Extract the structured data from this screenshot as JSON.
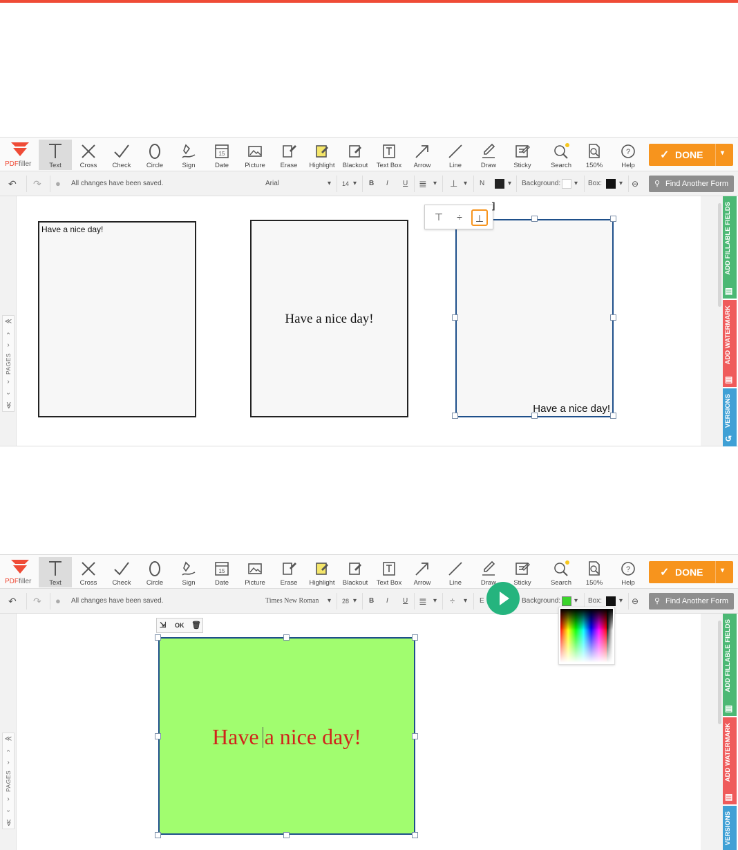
{
  "colors": {
    "accent": "#ef4b36",
    "done": "#f7941d",
    "fill_green": "#a1fd6f",
    "text_red": "#d0241b",
    "tab_green": "#4cb874",
    "tab_red": "#ef5b5b",
    "tab_blue": "#3fa0d5",
    "play": "#25b47e"
  },
  "brand": {
    "name_part1": "PDF",
    "name_part2": "filler"
  },
  "tools": {
    "text": "Text",
    "cross": "Cross",
    "check": "Check",
    "circle": "Circle",
    "sign": "Sign",
    "date": "Date",
    "date_icon_day": "15",
    "picture": "Picture",
    "erase": "Erase",
    "highlight": "Highlight",
    "blackout": "Blackout",
    "textbox": "Text Box",
    "arrow": "Arrow",
    "line": "Line",
    "draw": "Draw",
    "sticky": "Sticky",
    "search": "Search",
    "zoom": "150%",
    "help": "Help"
  },
  "done_button": {
    "check": "✓",
    "label": "DONE",
    "arrow": "▾"
  },
  "fmt": {
    "saved_status": "All changes have been saved.",
    "bold": "B",
    "italic": "I",
    "underline": "U",
    "background_label": "Background:",
    "box_label": "Box:",
    "n_label": "N",
    "e_label": "E",
    "find_form": "Find Another Form",
    "dropdown_arrow": "▾",
    "link_icon": "⊖"
  },
  "shot1": {
    "font": "Arial",
    "size": "14",
    "box1_text": "Have a nice day!",
    "box2_text": "Have a nice day!",
    "box3_text": "Have a nice day!",
    "valign_options": [
      "⊤",
      "÷",
      "⊥"
    ],
    "valign_selected": "⊥",
    "partial_icon": "]"
  },
  "shot2": {
    "font": "Times New Roman",
    "size": "28",
    "box_text": "Have a nice day!",
    "mini_toolbar": {
      "move": "⇲",
      "ok": "OK",
      "delete": "🗑"
    },
    "bg_color": "#39d42a"
  },
  "pages_nav": {
    "top": "≪",
    "up": "‹",
    "expand": "›",
    "label": "PAGES",
    "expand2": "›",
    "down": "›",
    "bottom": "≫"
  },
  "side_tabs": {
    "fields": "ADD FILLABLE FIELDS",
    "watermark": "ADD WATERMARK",
    "versions": "VERSIONS"
  }
}
